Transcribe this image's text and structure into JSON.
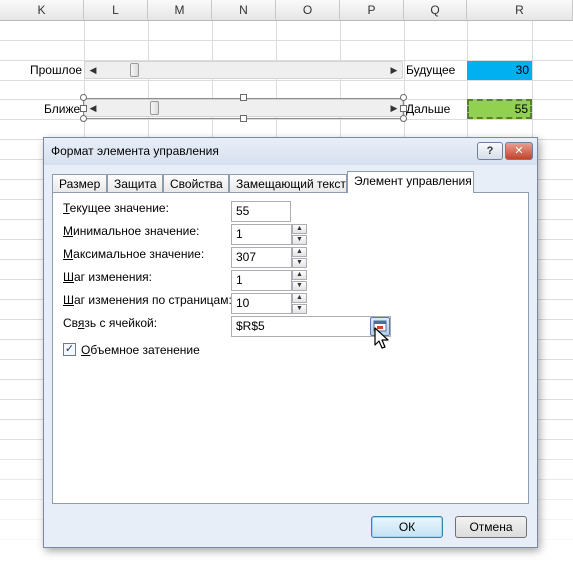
{
  "sheet": {
    "columns": [
      "K",
      "L",
      "M",
      "N",
      "O",
      "P",
      "Q",
      "R"
    ],
    "label_past": "Прошлое",
    "label_future": "Будущее",
    "label_near": "Ближе",
    "label_far": "Дальше",
    "cell_r5_value": "30",
    "cell_r7_value": "55",
    "colors": {
      "cell_r5": "#00b0f0",
      "cell_r7": "#92d050"
    }
  },
  "dialog": {
    "title": "Формат элемента управления",
    "help_label": "?",
    "close_label": "✕",
    "tabs": [
      "Размер",
      "Защита",
      "Свойства",
      "Замещающий текст",
      "Элемент управления"
    ],
    "active_tab": "Элемент управления",
    "fields": {
      "current_label_u": "Т",
      "current_label_rest": "екущее значение:",
      "current_value": "55",
      "min_label_u": "М",
      "min_label_rest": "инимальное значение:",
      "min_value": "1",
      "max_label_u": "М",
      "max_label_rest": "аксимальное значение:",
      "max_value": "307",
      "step_label_u": "Ш",
      "step_label_rest": "аг изменения:",
      "step_value": "1",
      "page_label_u": "Ш",
      "page_label_rest": "аг изменения по страницам:",
      "page_value": "10",
      "link_label_pre": "Св",
      "link_label_u": "я",
      "link_label_rest": "зь с ячейкой:",
      "link_value": "$R$5"
    },
    "shading_u": "О",
    "shading_rest": "бъемное затенение",
    "shading_checked": true,
    "ok_label": "ОК",
    "cancel_label": "Отмена"
  }
}
